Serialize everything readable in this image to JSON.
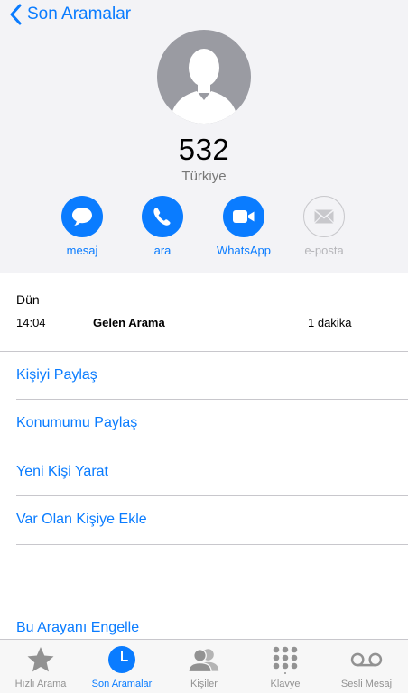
{
  "nav": {
    "back_label": "Son Aramalar"
  },
  "contact": {
    "number": "532",
    "country": "Türkiye"
  },
  "actions": [
    {
      "label": "mesaj",
      "icon": "message-bubble-icon",
      "enabled": true
    },
    {
      "label": "ara",
      "icon": "phone-icon",
      "enabled": true
    },
    {
      "label": "WhatsApp",
      "icon": "video-icon",
      "enabled": true
    },
    {
      "label": "e-posta",
      "icon": "mail-icon",
      "enabled": false
    }
  ],
  "call_log": {
    "date": "Dün",
    "time": "14:04",
    "type": "Gelen Arama",
    "duration": "1 dakika"
  },
  "menu": {
    "share_contact": "Kişiyi Paylaş",
    "share_location": "Konumumu Paylaş",
    "new_contact": "Yeni Kişi Yarat",
    "add_existing": "Var Olan Kişiye Ekle",
    "block_caller": "Bu Arayanı Engelle"
  },
  "tabs": [
    {
      "label": "Hızlı Arama",
      "icon": "star-icon",
      "active": false
    },
    {
      "label": "Son Aramalar",
      "icon": "clock-icon",
      "active": true
    },
    {
      "label": "Kişiler",
      "icon": "contacts-icon",
      "active": false
    },
    {
      "label": "Klavye",
      "icon": "keypad-icon",
      "active": false
    },
    {
      "label": "Sesli Mesaj",
      "icon": "voicemail-icon",
      "active": false
    }
  ],
  "colors": {
    "accent": "#0a7cff",
    "header_bg": "#f3f3f6",
    "inactive": "#929292",
    "separator": "#c8c7cc"
  }
}
